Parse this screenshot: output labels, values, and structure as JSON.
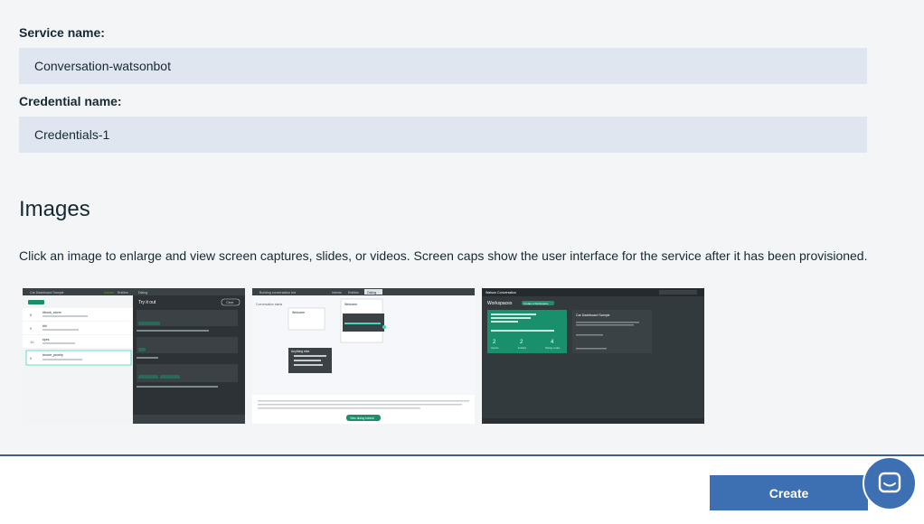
{
  "form": {
    "service_label": "Service name:",
    "service_value": "Conversation-watsonbot",
    "credential_label": "Credential name:",
    "credential_value": "Credentials-1"
  },
  "images": {
    "title": "Images",
    "description": "Click an image to enlarge and view screen captures, slides, or videos. Screen caps show the user interface for the service after it has been provisioned.",
    "thumbnails": [
      {
        "icon": "screenshot-thumbnail",
        "tab_labels": [
          "Car Dashboard Sample",
          "Intents",
          "Entities",
          "Dialog"
        ],
        "panel_title": "Try it out",
        "panel_button": "Clear",
        "list_items": [
          "#book_storm",
          "#hi",
          "#yes",
          "#route_priority"
        ],
        "list_counts": [
          "8",
          "9",
          "10",
          "5"
        ]
      },
      {
        "icon": "screenshot-thumbnail",
        "tab_labels": [
          "Building conversation bot",
          "Intents",
          "Entities",
          "Dialog"
        ],
        "node_labels": [
          "Conversation starts",
          "Welcome",
          "Welcome",
          "Anything else"
        ],
        "action_button": "View dialog tutorial"
      },
      {
        "icon": "screenshot-thumbnail",
        "header_title": "Watson Conversation",
        "workspaces_title": "Workspaces",
        "create_button": "Create a Workspace",
        "card_title": "Car Dashboard Sample",
        "stats_values": [
          "2",
          "2",
          "4"
        ],
        "stats_labels": [
          "Intents",
          "Entities",
          "Dialog nodes"
        ]
      }
    ]
  },
  "footer": {
    "create_label": "Create",
    "chat_icon": "chat-bubble-icon"
  },
  "colors": {
    "accent": "#3d70b2",
    "input_bg": "#dfe6f0",
    "divider": "#3d5f8a",
    "watson_green": "#1a8f6b"
  }
}
